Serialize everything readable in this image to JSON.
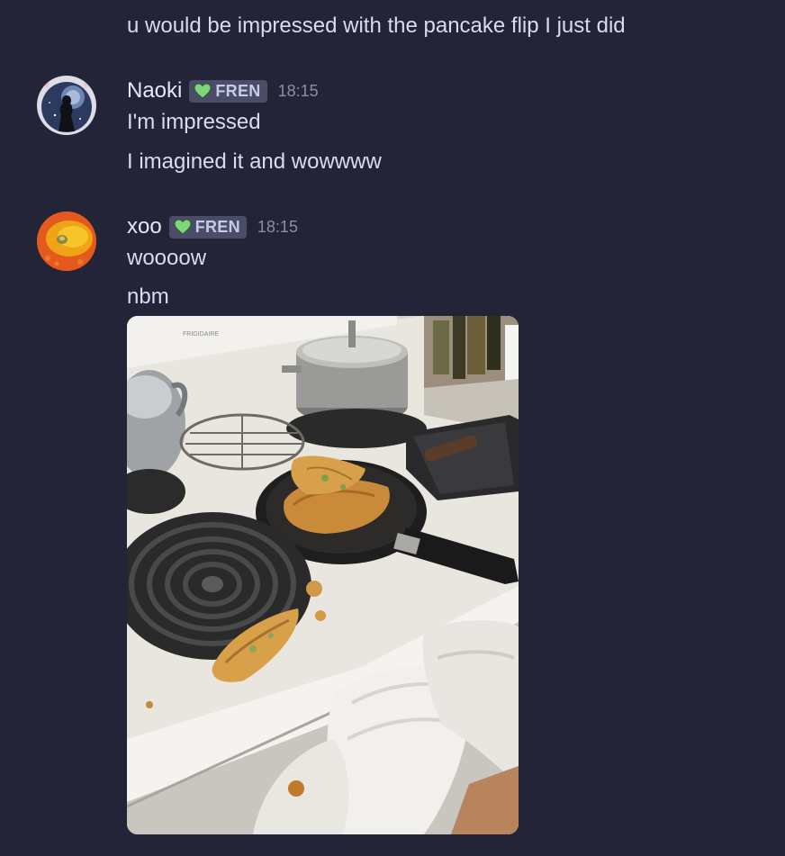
{
  "messages": {
    "prev_text": "u would be impressed with the pancake flip I just did",
    "naoki": {
      "username": "Naoki",
      "badge": "FREN",
      "time": "18:15",
      "lines": [
        "I'm impressed",
        "I imagined it and wowwww"
      ]
    },
    "xoo": {
      "username": "xoo",
      "badge": "FREN",
      "time": "18:15",
      "lines": [
        "woooow",
        "nbm"
      ],
      "attachment": {
        "brand": "FRIGIDAIRE",
        "icon": "image-attachment"
      }
    }
  },
  "colors": {
    "background": "#232437",
    "text": "#d9dbf1",
    "badge_bg": "#4a4c68",
    "heart": "#7fd67a",
    "timestamp": "#8b8ea8"
  }
}
